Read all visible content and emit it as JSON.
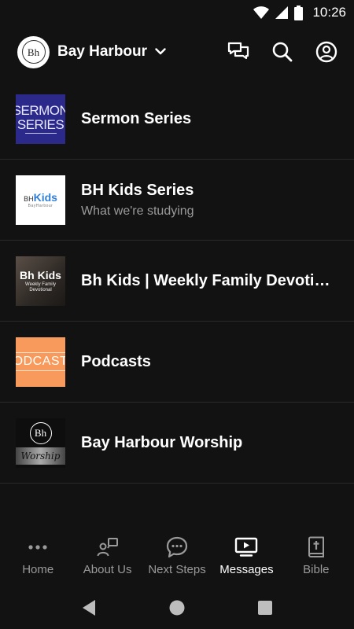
{
  "status_bar": {
    "time": "10:26"
  },
  "header": {
    "logo_text": "Bh",
    "org_name": "Bay Harbour"
  },
  "items": [
    {
      "title": "Sermon Series",
      "subtitle": "",
      "thumb_lines": [
        "SERMON",
        "SERIES"
      ]
    },
    {
      "title": "BH Kids Series",
      "subtitle": "What we're studying",
      "thumb_lines": [
        "BH",
        "Kids",
        "BayHarbour"
      ]
    },
    {
      "title": "Bh Kids | Weekly Family Devotio…",
      "subtitle": "",
      "thumb_lines": [
        "Bh Kids",
        "Weekly Family",
        "Devotional"
      ]
    },
    {
      "title": "Podcasts",
      "subtitle": "",
      "thumb_lines": [
        "PODCASTS"
      ]
    },
    {
      "title": "Bay Harbour Worship",
      "subtitle": "",
      "thumb_lines": [
        "Bh",
        "Worship"
      ]
    }
  ],
  "bottom_nav": [
    {
      "label": "Home",
      "icon": "dots-icon",
      "active": false
    },
    {
      "label": "About Us",
      "icon": "person-info-icon",
      "active": false
    },
    {
      "label": "Next Steps",
      "icon": "chat-bubble-icon",
      "active": false
    },
    {
      "label": "Messages",
      "icon": "play-screen-icon",
      "active": true
    },
    {
      "label": "Bible",
      "icon": "bible-icon",
      "active": false
    }
  ],
  "colors": {
    "background": "#121212",
    "divider": "#2a2a2a",
    "inactive": "#9a9a9a",
    "active": "#ffffff",
    "sermon_thumb": "#2b2a8a",
    "podcast_thumb": "#f79a5b"
  }
}
